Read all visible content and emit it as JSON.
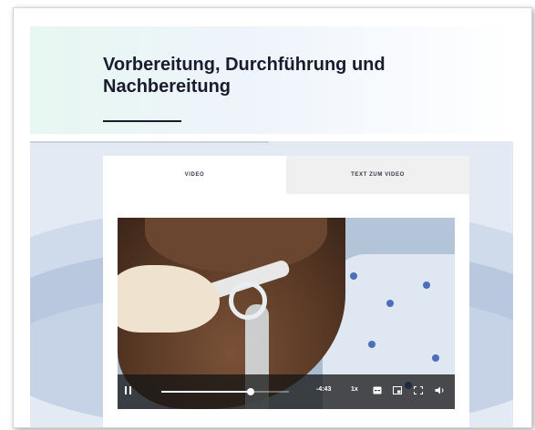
{
  "section": {
    "title": "Vorbereitung, Durchführung und Nachbereitung"
  },
  "tabs": [
    {
      "label": "VIDEO",
      "active": true
    },
    {
      "label": "TEXT ZUM VIDEO",
      "active": false
    }
  ],
  "player": {
    "state": "playing",
    "time_remaining": "-4:43",
    "speed": "1x",
    "progress": 0.7,
    "icons": [
      "pause-icon",
      "captions-icon",
      "picture-in-picture-icon",
      "fullscreen-icon",
      "volume-icon"
    ]
  },
  "colors": {
    "title": "#1b1b2e",
    "stage_bg": "#e4eaf4",
    "controls_bg": "#141414"
  }
}
